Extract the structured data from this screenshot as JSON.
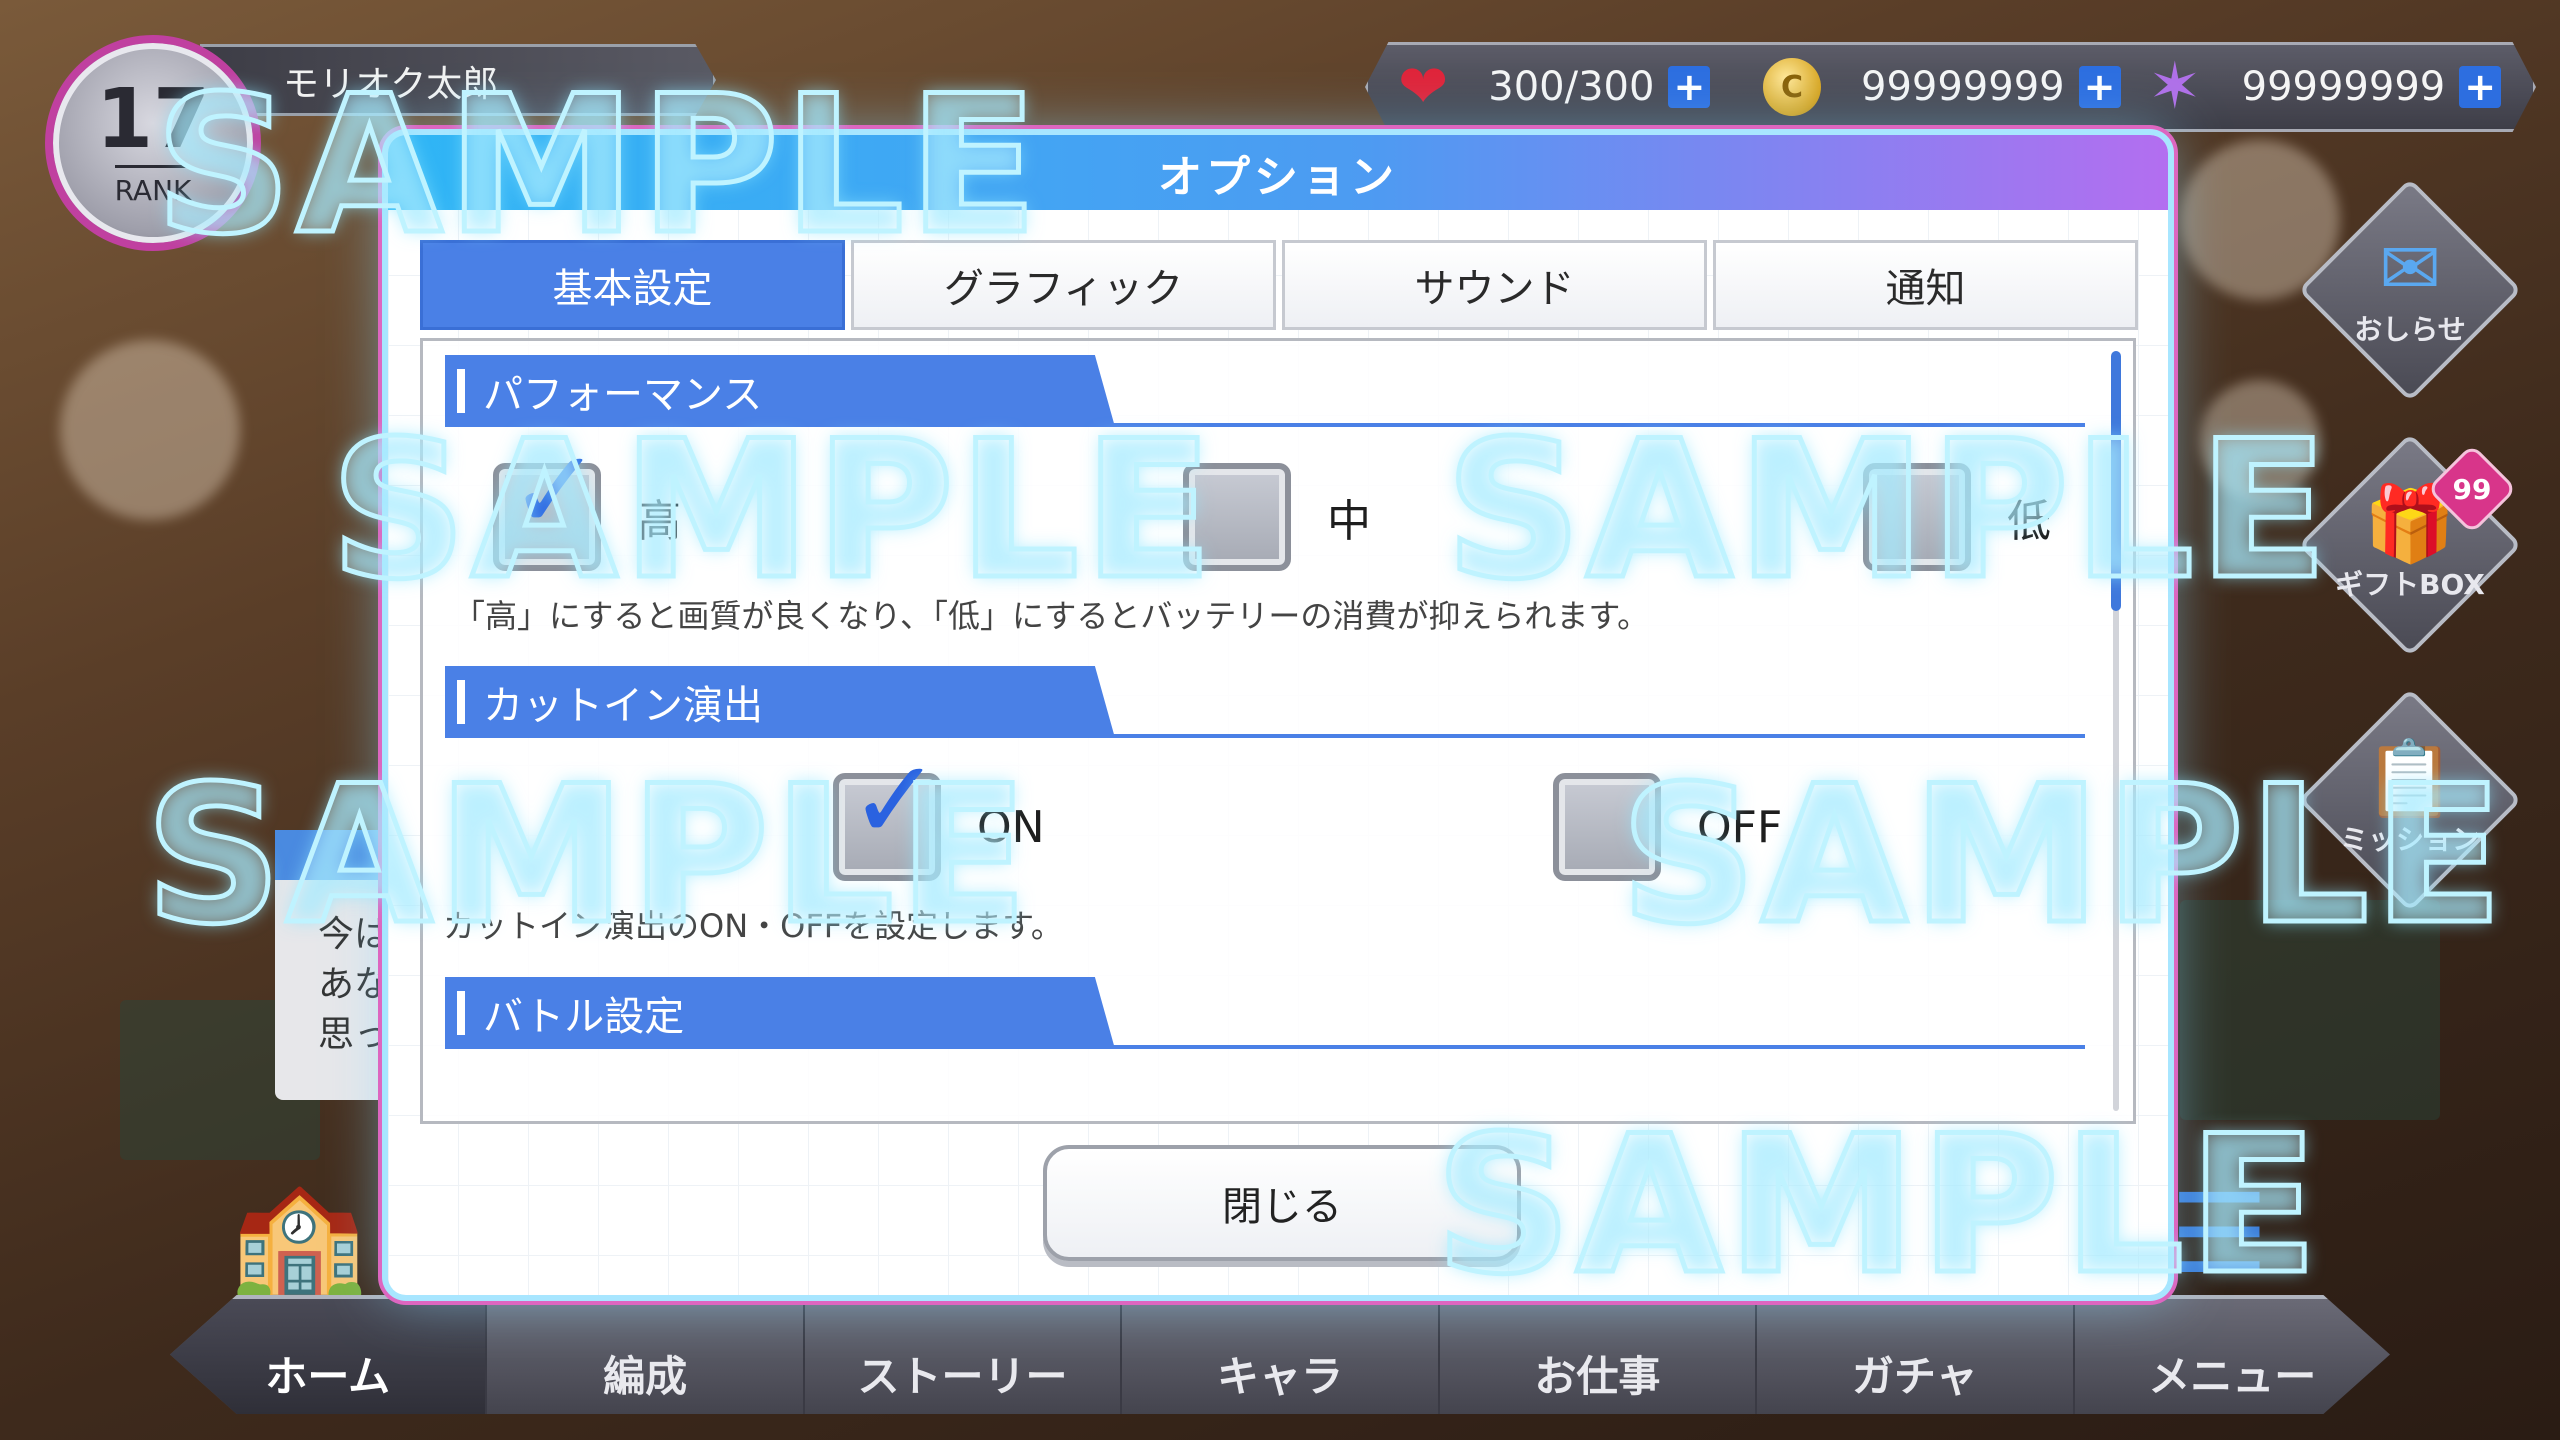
{
  "player": {
    "rank": "17",
    "rank_label": "RANK",
    "name": "モリオク太郎"
  },
  "resources": [
    {
      "icon": "heart-icon",
      "value": "300/300",
      "plus": "+"
    },
    {
      "icon": "coin-icon",
      "symbol": "C",
      "value": "99999999",
      "plus": "+"
    },
    {
      "icon": "star-gem-icon",
      "value": "99999999",
      "plus": "+"
    }
  ],
  "side_buttons": [
    {
      "icon": "mail-icon",
      "label": "おしらせ"
    },
    {
      "icon": "gift-icon",
      "label": "ギフトBOX",
      "badge": "99"
    },
    {
      "icon": "mission-icon",
      "label": "ミッション"
    }
  ],
  "background_dialog": {
    "lines": [
      "今は",
      "あな",
      "思っ"
    ]
  },
  "modal": {
    "title": "オプション",
    "tabs": [
      "基本設定",
      "グラフィック",
      "サウンド",
      "通知"
    ],
    "active_tab": "基本設定",
    "sections": [
      {
        "title": "パフォーマンス",
        "options": [
          {
            "label": "高",
            "checked": true
          },
          {
            "label": "中",
            "checked": false
          },
          {
            "label": "低",
            "checked": false
          }
        ],
        "description": "「高」にすると画質が良くなり、「低」にするとバッテリーの消費が抑えられます。"
      },
      {
        "title": "カットイン演出",
        "options": [
          {
            "label": "ON",
            "checked": true
          },
          {
            "label": "OFF",
            "checked": false
          }
        ],
        "description": "カットイン演出のON・OFFを設定します。"
      },
      {
        "title": "バトル設定"
      }
    ],
    "close_label": "閉じる"
  },
  "bottom_nav": [
    {
      "label": "ホーム",
      "active": true
    },
    {
      "label": "編成"
    },
    {
      "label": "ストーリー"
    },
    {
      "label": "キャラ"
    },
    {
      "label": "お仕事"
    },
    {
      "label": "ガチャ"
    },
    {
      "label": "メニュー"
    }
  ],
  "watermark": "SAMPLE",
  "colors": {
    "accent_blue": "#4a80e6",
    "header_start": "#2fb6f5",
    "header_end": "#b36ef0",
    "badge_pink": "#d8358a"
  }
}
